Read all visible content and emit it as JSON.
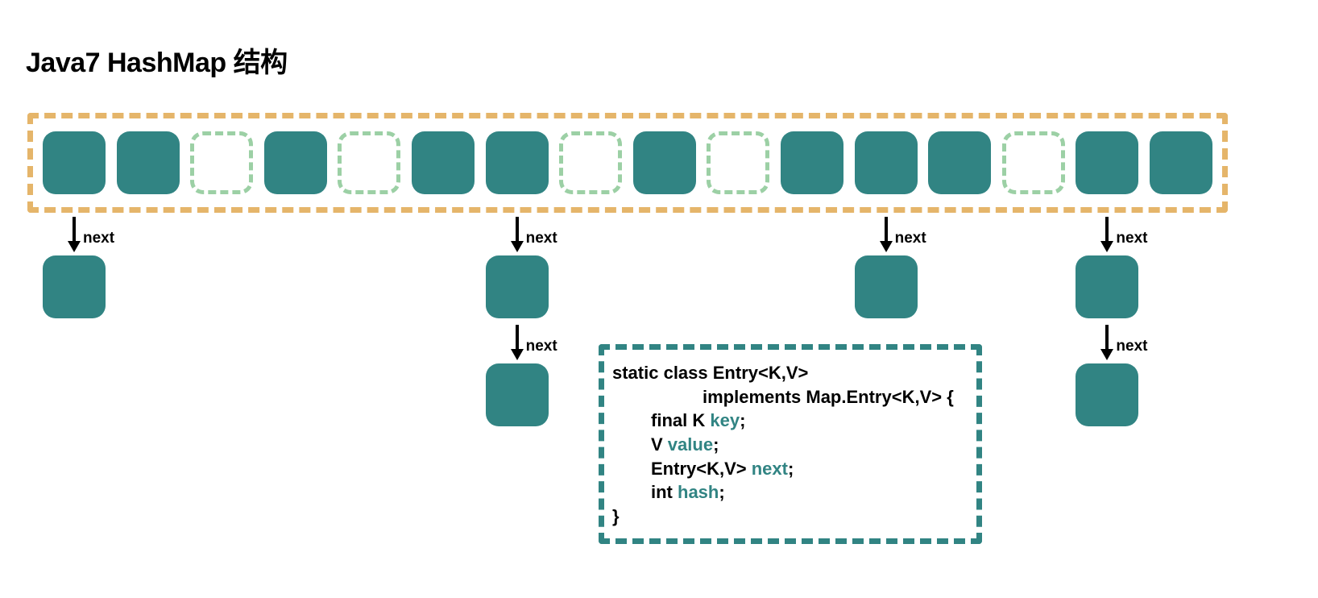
{
  "title": "Java7 HashMap 结构",
  "array": [
    {
      "type": "filled"
    },
    {
      "type": "filled"
    },
    {
      "type": "empty"
    },
    {
      "type": "filled"
    },
    {
      "type": "empty"
    },
    {
      "type": "filled"
    },
    {
      "type": "filled"
    },
    {
      "type": "empty"
    },
    {
      "type": "filled"
    },
    {
      "type": "empty"
    },
    {
      "type": "filled"
    },
    {
      "type": "filled"
    },
    {
      "type": "filled"
    },
    {
      "type": "empty"
    },
    {
      "type": "filled"
    },
    {
      "type": "filled"
    }
  ],
  "arrow_label": "next",
  "chains": [
    {
      "bucket_index": 0,
      "nodes": 1
    },
    {
      "bucket_index": 6,
      "nodes": 2
    },
    {
      "bucket_index": 11,
      "nodes": 1
    },
    {
      "bucket_index": 14,
      "nodes": 2
    }
  ],
  "code": {
    "line1_a": "static class Entry<K,V>",
    "line1_b": "implements Map.Entry<K,V> {",
    "line2_a": "final K ",
    "line2_field": "key",
    "line2_b": ";",
    "line3_a": "V ",
    "line3_field": "value",
    "line3_b": ";",
    "line4_a": "Entry<K,V> ",
    "line4_field": "next",
    "line4_b": ";",
    "line5_a": "int ",
    "line5_field": "hash",
    "line5_b": ";",
    "line6": "}"
  },
  "colors": {
    "teal": "#318483",
    "orange_dash": "#e5b56a",
    "green_dash": "#9cd0a5"
  }
}
